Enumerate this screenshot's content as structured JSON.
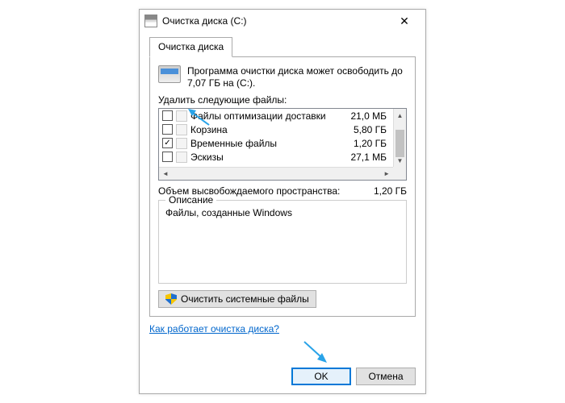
{
  "window": {
    "title": "Очистка диска (C:)"
  },
  "tab": {
    "label": "Очистка диска"
  },
  "info": {
    "text": "Программа очистки диска может освободить до 7,07 ГБ на  (C:)."
  },
  "list_label": "Удалить следующие файлы:",
  "files": [
    {
      "label": "Файлы оптимизации доставки",
      "size": "21,0 МБ",
      "checked": false
    },
    {
      "label": "Корзина",
      "size": "5,80 ГБ",
      "checked": false
    },
    {
      "label": "Временные файлы",
      "size": "1,20 ГБ",
      "checked": true
    },
    {
      "label": "Эскизы",
      "size": "27,1 МБ",
      "checked": false
    }
  ],
  "total": {
    "label": "Объем высвобождаемого пространства:",
    "value": "1,20 ГБ"
  },
  "description": {
    "title": "Описание",
    "text": "Файлы, созданные Windows"
  },
  "sysfiles_button": "Очистить системные файлы",
  "help_link": "Как работает очистка диска?",
  "buttons": {
    "ok": "OK",
    "cancel": "Отмена"
  }
}
